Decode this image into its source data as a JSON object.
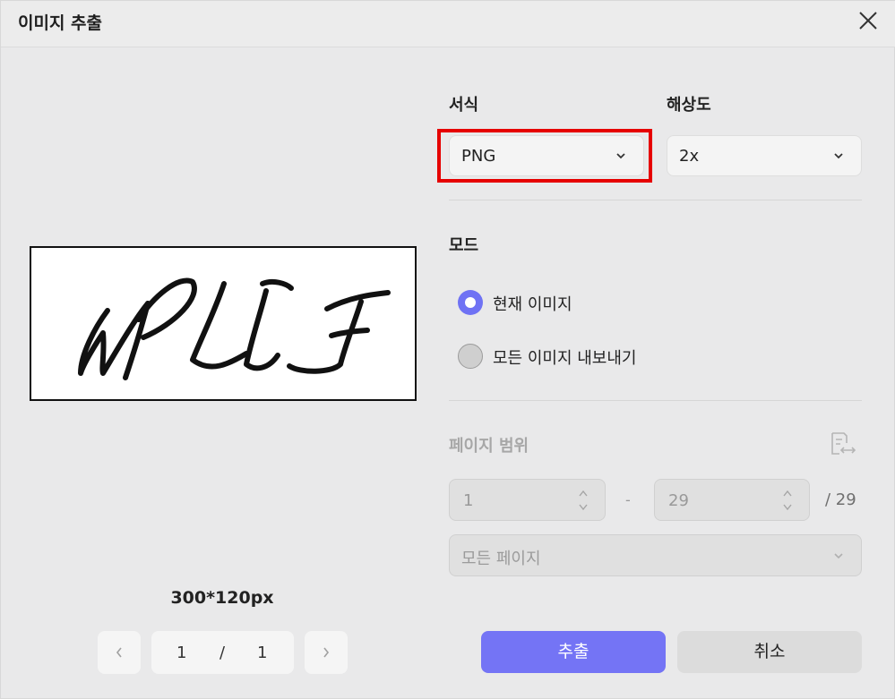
{
  "dialog": {
    "title": "이미지 추출"
  },
  "preview": {
    "dimensions": "300*120px"
  },
  "pagination": {
    "current": "1",
    "separator": "/",
    "total": "1"
  },
  "format": {
    "label": "서식",
    "selected": "PNG"
  },
  "resolution": {
    "label": "해상도",
    "selected": "2x"
  },
  "mode": {
    "label": "모드",
    "options": [
      {
        "label": "현재 이미지",
        "selected": true
      },
      {
        "label": "모든 이미지 내보내기",
        "selected": false
      }
    ]
  },
  "page_range": {
    "label": "페이지 범위",
    "from": "1",
    "dash": "-",
    "to": "29",
    "total": "/ 29",
    "scope": "모든 페이지"
  },
  "buttons": {
    "extract": "추출",
    "cancel": "취소"
  },
  "colors": {
    "accent": "#7474f5",
    "highlight": "#e60000"
  }
}
